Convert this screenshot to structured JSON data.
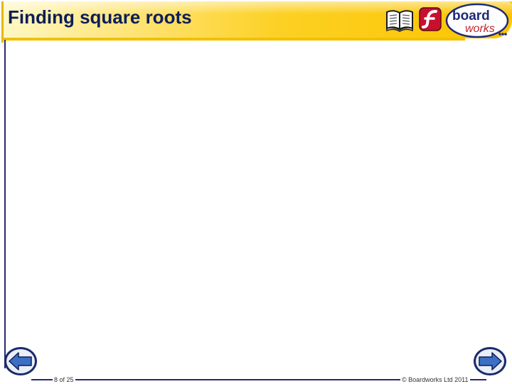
{
  "slide": {
    "title": "Finding square roots",
    "page": "8 of 25",
    "copyright": "© Boardworks Ltd 2011"
  },
  "header_icons": {
    "book": "book-icon",
    "flash": "flash-icon"
  },
  "logo": {
    "line1": "board",
    "line2": "works"
  },
  "nav": {
    "prev": "arrow-left-icon",
    "next": "arrow-right-icon"
  },
  "colors": {
    "title": "#0c1d5a",
    "header_yellow": "#fcd022",
    "logo_navy": "#1f2a78",
    "logo_red": "#c0262d",
    "flash_red": "#c8102e",
    "nav_blue": "#3a6fc4"
  }
}
